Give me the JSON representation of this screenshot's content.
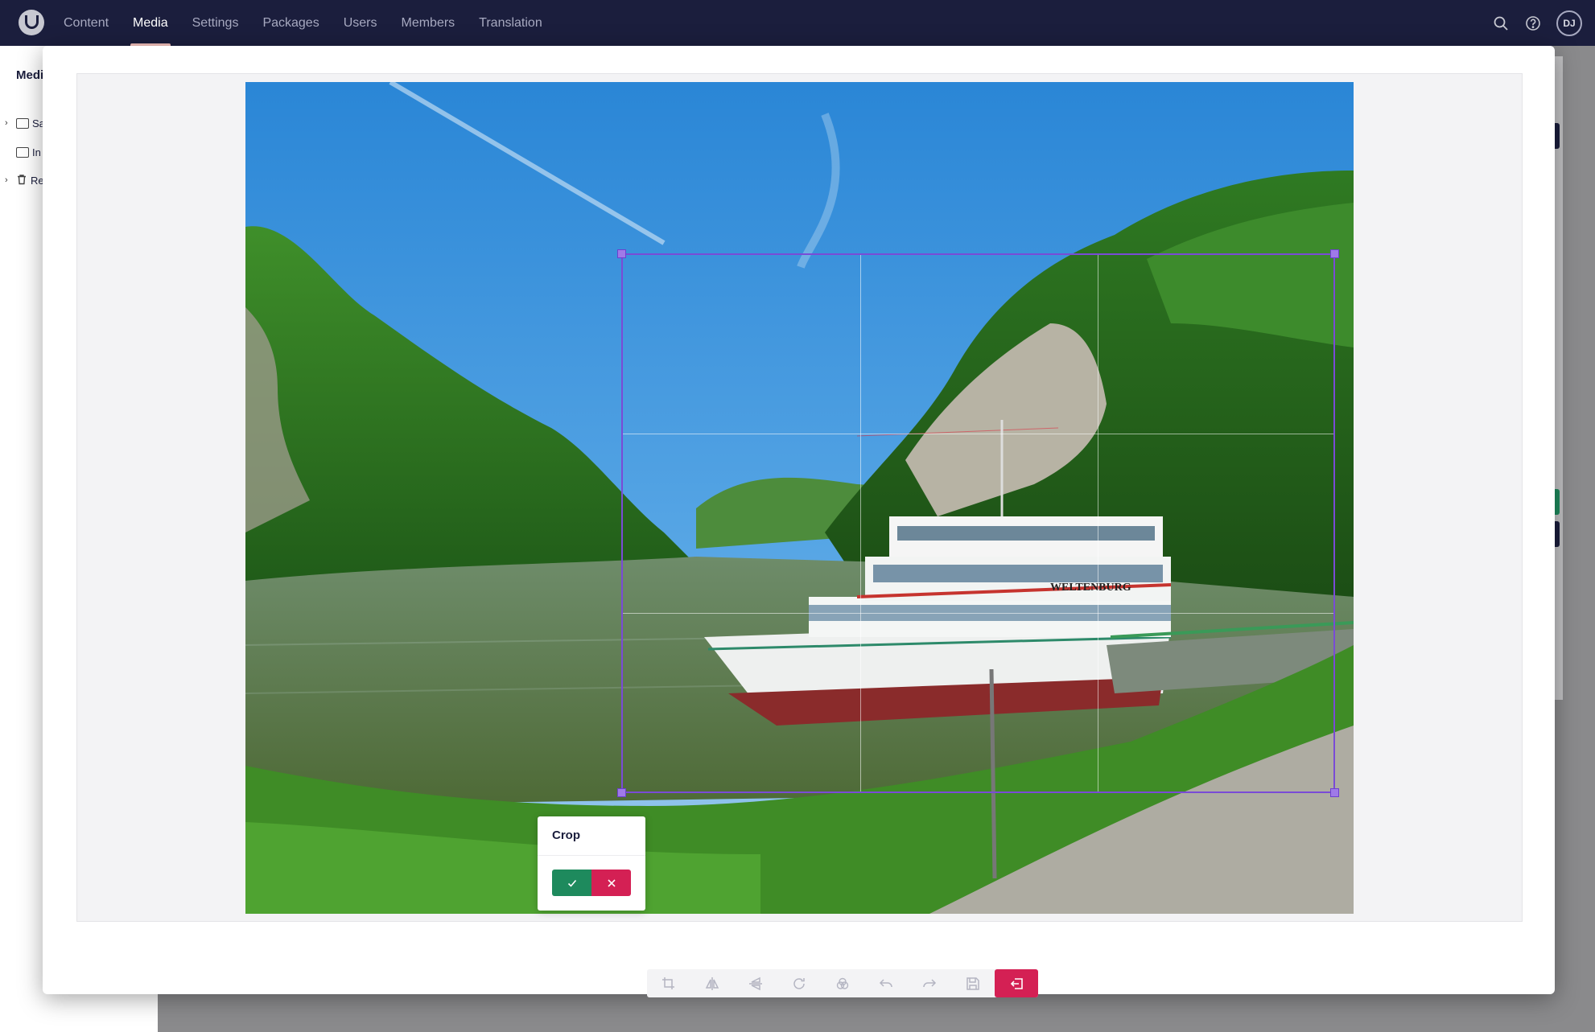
{
  "nav": {
    "items": [
      {
        "label": "Content"
      },
      {
        "label": "Media"
      },
      {
        "label": "Settings"
      },
      {
        "label": "Packages"
      },
      {
        "label": "Users"
      },
      {
        "label": "Members"
      },
      {
        "label": "Translation"
      }
    ],
    "active": "Media",
    "user_initials": "DJ",
    "icons": [
      "search-icon",
      "help-icon"
    ]
  },
  "sidebar": {
    "title": "Medi",
    "items": [
      {
        "label": "Sa",
        "icon": "media-folder-icon"
      },
      {
        "label": "In",
        "icon": "media-folder-icon"
      },
      {
        "label": "Re",
        "icon": "trash-icon"
      }
    ]
  },
  "image": {
    "boat_name": "WELTENBURG"
  },
  "crop_popup": {
    "title": "Crop",
    "apply_icon": "check-icon",
    "cancel_icon": "close-icon"
  },
  "toolbar": {
    "tools": [
      "crop-icon",
      "flip-horizontal-icon",
      "flip-vertical-icon",
      "rotate-icon",
      "filter-icon",
      "undo-icon",
      "redo-icon",
      "save-icon",
      "exit-icon"
    ]
  },
  "colors": {
    "topbar": "#1b1e3d",
    "crop_border": "#7a4bd6",
    "apply": "#1e8a5d",
    "cancel": "#d42054"
  }
}
